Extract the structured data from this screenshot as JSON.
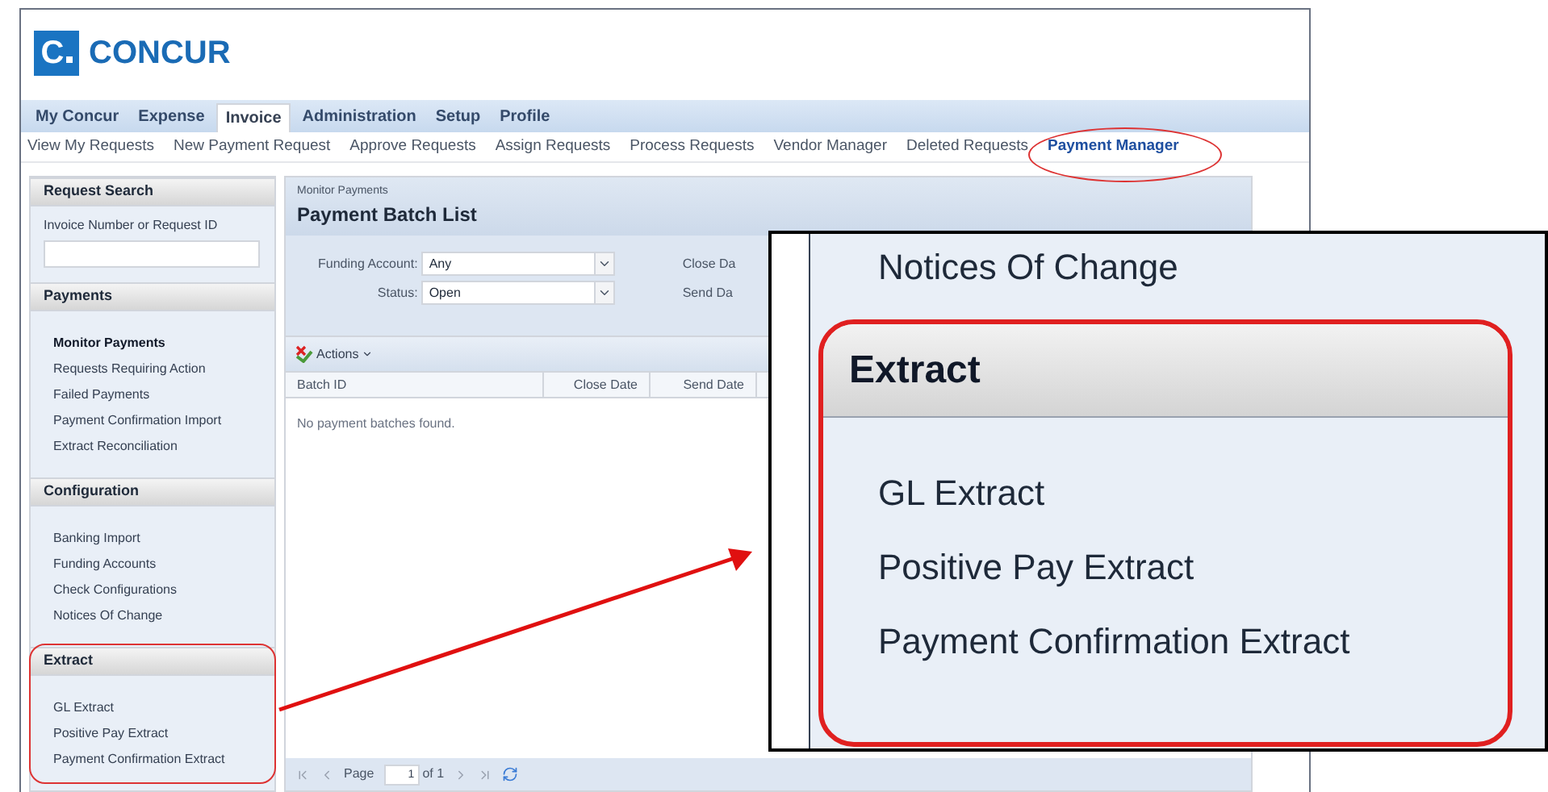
{
  "logo": {
    "mark": "C",
    "name": "CONCUR"
  },
  "tabs": [
    {
      "label": "My Concur",
      "selected": false
    },
    {
      "label": "Expense",
      "selected": false
    },
    {
      "label": "Invoice",
      "selected": true
    },
    {
      "label": "Administration",
      "selected": false
    },
    {
      "label": "Setup",
      "selected": false
    },
    {
      "label": "Profile",
      "selected": false
    }
  ],
  "subnav": [
    {
      "label": "View My Requests",
      "selected": false
    },
    {
      "label": "New Payment Request",
      "selected": false
    },
    {
      "label": "Approve Requests",
      "selected": false
    },
    {
      "label": "Assign Requests",
      "selected": false
    },
    {
      "label": "Process Requests",
      "selected": false
    },
    {
      "label": "Vendor Manager",
      "selected": false
    },
    {
      "label": "Deleted Requests",
      "selected": false
    },
    {
      "label": "Payment Manager",
      "selected": true
    }
  ],
  "sidebar": [
    {
      "title": "Request Search",
      "field_label": "Invoice Number or Request ID"
    },
    {
      "title": "Payments",
      "items": [
        {
          "label": "Monitor Payments",
          "selected": true
        },
        {
          "label": "Requests Requiring Action",
          "selected": false
        },
        {
          "label": "Failed Payments",
          "selected": false
        },
        {
          "label": "Payment Confirmation Import",
          "selected": false
        },
        {
          "label": "Extract Reconciliation",
          "selected": false
        }
      ]
    },
    {
      "title": "Configuration",
      "items": [
        {
          "label": "Banking Import",
          "selected": false
        },
        {
          "label": "Funding Accounts",
          "selected": false
        },
        {
          "label": "Check Configurations",
          "selected": false
        },
        {
          "label": "Notices Of Change",
          "selected": false
        }
      ]
    },
    {
      "title": "Extract",
      "items": [
        {
          "label": "GL Extract",
          "selected": false
        },
        {
          "label": "Positive Pay Extract",
          "selected": false
        },
        {
          "label": "Payment Confirmation Extract",
          "selected": false
        }
      ]
    }
  ],
  "main": {
    "breadcrumb": "Monitor Payments",
    "title": "Payment Batch List",
    "filters": [
      {
        "label": "Funding Account:",
        "value": "Any"
      },
      {
        "label": "Status:",
        "value": "Open"
      }
    ],
    "side_filters": [
      "Close Da",
      "Send Da"
    ],
    "actions": "Actions",
    "columns": [
      "Batch ID",
      "Close Date",
      "Send Date"
    ],
    "empty": "No payment batches found.",
    "pager": {
      "label": "Page",
      "value": "1",
      "of": "of 1"
    }
  },
  "zoom_inset": {
    "above": "Notices Of Change",
    "header": "Extract",
    "items": [
      "GL Extract",
      "Positive Pay Extract",
      "Payment Confirmation Extract"
    ]
  }
}
